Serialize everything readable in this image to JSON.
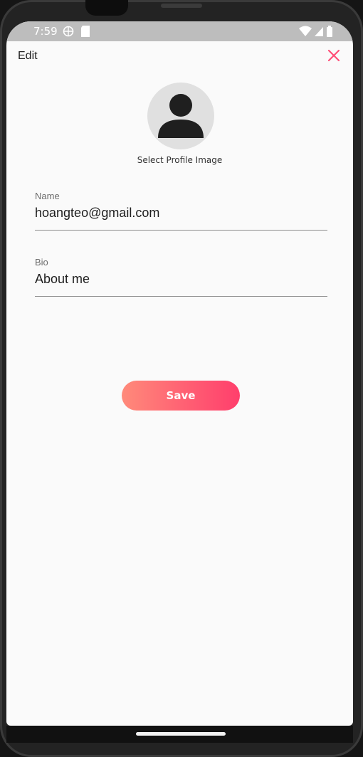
{
  "status_bar": {
    "time": "7:59",
    "icons": [
      "globe-icon",
      "sd-card-icon",
      "wifi-icon",
      "signal-icon",
      "battery-icon"
    ]
  },
  "header": {
    "title": "Edit",
    "close_icon": "close-icon"
  },
  "profile": {
    "avatar_icon": "person-icon",
    "select_label": "Select Profile Image"
  },
  "form": {
    "name": {
      "label": "Name",
      "value": "hoangteo@gmail.com"
    },
    "bio": {
      "label": "Bio",
      "value": "About me"
    }
  },
  "actions": {
    "save_label": "Save"
  },
  "colors": {
    "accent": "#ff4f78",
    "save_gradient_start": "#ff8a7a",
    "save_gradient_end": "#ff3f6c",
    "status_bar": "#bdbdbd",
    "screen_background": "#fafafa"
  }
}
